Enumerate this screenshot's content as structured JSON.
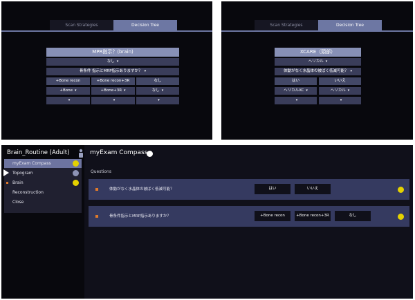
{
  "tabs": {
    "scan": "Scan Strategies",
    "decision": "Decision Tree"
  },
  "tree_left": {
    "header": "MPR指示？(brain)",
    "row1": "なし",
    "question": "骨条件 指示とMRP指示ありますか？",
    "opt1": "+Bone recon",
    "opt2": "+Bone recon+3R",
    "opt3": "なし",
    "sub1": "+Bone",
    "sub2": "+Bone+3R",
    "sub3": "なし",
    "caret": "▾"
  },
  "tree_right": {
    "header": "XCARE（頭部）",
    "row1": "ヘリカル",
    "question": "体動がなく水晶体の被ばく低減可能？",
    "opt1": "はい",
    "opt2": "いいえ",
    "sub1": "ヘリカルXC",
    "sub2": "ヘリカル",
    "caret": "▾"
  },
  "sidebar": {
    "title": "Brain_Routine (Adult)",
    "items": [
      "myExam Compass",
      "Topogram",
      "Brain",
      "Reconstruction",
      "Close"
    ]
  },
  "main": {
    "title": "myExam Compass",
    "questions_label": "Questions",
    "q1": {
      "text": "体動がなく水晶体の被ばく低減可能？",
      "options": [
        "はい",
        "いいえ"
      ]
    },
    "q2": {
      "text": "骨条件指示とMRP指示ありますか？",
      "options": [
        "+Bone recon",
        "+Bone recon+3R",
        "なし"
      ]
    }
  },
  "colors": {
    "accent": "#6d77a3",
    "header": "#8790b6",
    "cell": "#3a3d5a",
    "row": "#353a60",
    "bullet": "#e07a2a",
    "warn": "#e4d100"
  }
}
